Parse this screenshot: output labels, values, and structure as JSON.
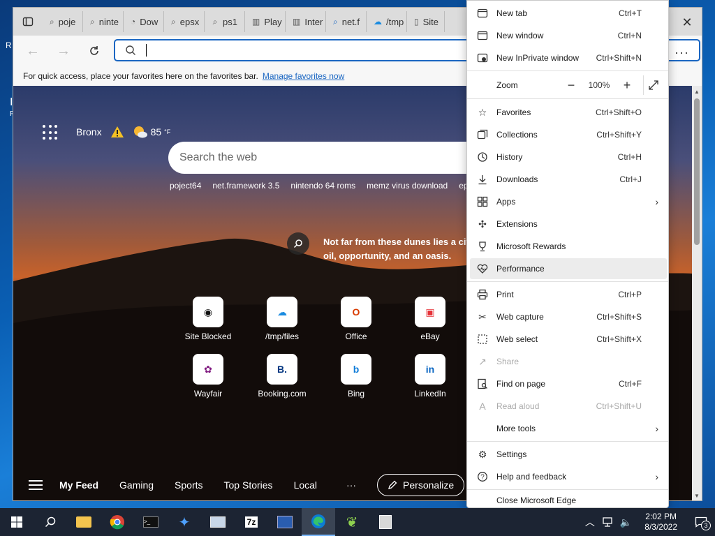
{
  "desktop": {
    "left_chars": [
      "R",
      "I",
      "P"
    ]
  },
  "tabs": [
    {
      "icon": "search-icon",
      "label": "poje"
    },
    {
      "icon": "search-icon",
      "label": "ninte"
    },
    {
      "icon": "download-icon",
      "label": "Dow"
    },
    {
      "icon": "search-icon",
      "label": "epsx"
    },
    {
      "icon": "search-icon",
      "label": "ps1"
    },
    {
      "icon": "archive-icon",
      "label": "Play"
    },
    {
      "icon": "archive-icon",
      "label": "Inter"
    },
    {
      "icon": "search-icon",
      "label": "net.f"
    },
    {
      "icon": "cloud-icon",
      "label": "/tmp"
    },
    {
      "icon": "page-icon",
      "label": "Site"
    }
  ],
  "address_bar": {
    "value": ""
  },
  "favorites_bar": {
    "text": "For quick access, place your favorites here on the favorites bar.",
    "link": "Manage favorites now"
  },
  "newtab": {
    "location": "Bronx",
    "temperature": "85",
    "temp_unit": "°F",
    "search_placeholder": "Search the web",
    "trending": [
      "poject64",
      "net.framework 3.5",
      "nintendo 64 roms",
      "memz virus download",
      "eps"
    ],
    "caption": "Not far from these dunes lies a cit oil, opportunity, and an oasis.",
    "tiles": [
      {
        "label": "Site Blocked",
        "icon": "github-icon",
        "glyph": "◉",
        "color": "#111111"
      },
      {
        "label": "/tmp/files",
        "icon": "cloud-upload-icon",
        "glyph": "☁",
        "color": "#1a8be0"
      },
      {
        "label": "Office",
        "icon": "office-icon",
        "glyph": "O",
        "color": "#d83b01"
      },
      {
        "label": "eBay",
        "icon": "ebay-icon",
        "glyph": "▣",
        "color": "#e53238"
      },
      {
        "label": "Wayfair",
        "icon": "wayfair-icon",
        "glyph": "✿",
        "color": "#7f187f"
      },
      {
        "label": "Booking.com",
        "icon": "booking-icon",
        "glyph": "B.",
        "color": "#003580"
      },
      {
        "label": "Bing",
        "icon": "bing-icon",
        "glyph": "b",
        "color": "#0f7cd8"
      },
      {
        "label": "LinkedIn",
        "icon": "linkedin-icon",
        "glyph": "in",
        "color": "#0a66c2"
      }
    ],
    "feed": {
      "my_feed": "My Feed",
      "items": [
        "Gaming",
        "Sports",
        "Top Stories",
        "Local"
      ],
      "more": "···",
      "personalize": "Personalize"
    }
  },
  "menu": {
    "new_tab": {
      "label": "New tab",
      "shortcut": "Ctrl+T"
    },
    "new_window": {
      "label": "New window",
      "shortcut": "Ctrl+N"
    },
    "new_inprivate": {
      "label": "New InPrivate window",
      "shortcut": "Ctrl+Shift+N"
    },
    "zoom": {
      "label": "Zoom",
      "value": "100%"
    },
    "favorites": {
      "label": "Favorites",
      "shortcut": "Ctrl+Shift+O"
    },
    "collections": {
      "label": "Collections",
      "shortcut": "Ctrl+Shift+Y"
    },
    "history": {
      "label": "History",
      "shortcut": "Ctrl+H"
    },
    "downloads": {
      "label": "Downloads",
      "shortcut": "Ctrl+J"
    },
    "apps": {
      "label": "Apps"
    },
    "extensions": {
      "label": "Extensions"
    },
    "rewards": {
      "label": "Microsoft Rewards"
    },
    "performance": {
      "label": "Performance"
    },
    "print": {
      "label": "Print",
      "shortcut": "Ctrl+P"
    },
    "web_capture": {
      "label": "Web capture",
      "shortcut": "Ctrl+Shift+S"
    },
    "web_select": {
      "label": "Web select",
      "shortcut": "Ctrl+Shift+X"
    },
    "share": {
      "label": "Share"
    },
    "find": {
      "label": "Find on page",
      "shortcut": "Ctrl+F"
    },
    "read_aloud": {
      "label": "Read aloud",
      "shortcut": "Ctrl+Shift+U"
    },
    "more_tools": {
      "label": "More tools"
    },
    "settings": {
      "label": "Settings"
    },
    "help": {
      "label": "Help and feedback"
    },
    "close": {
      "label": "Close Microsoft Edge"
    }
  },
  "taskbar": {
    "time": "2:02 PM",
    "date": "8/3/2022",
    "notifications": "3"
  }
}
